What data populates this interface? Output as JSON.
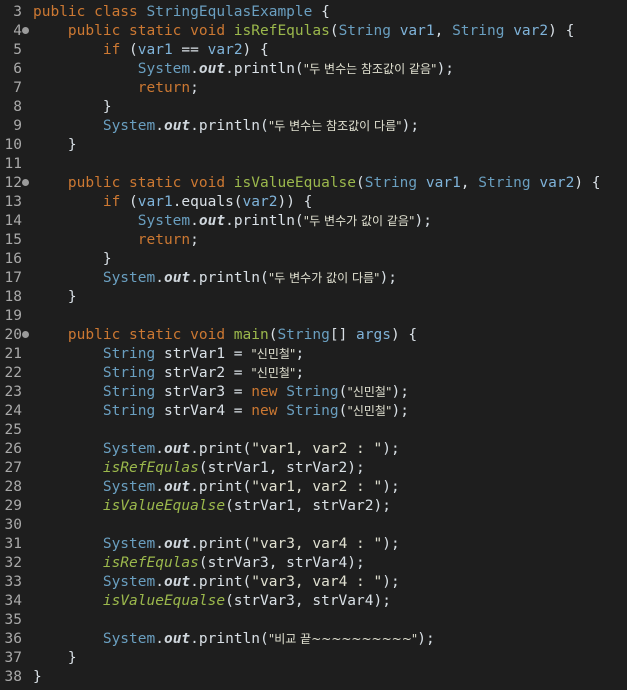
{
  "editor": {
    "lines": [
      {
        "n": "3",
        "fold": false,
        "t": [
          [
            "kw",
            "public "
          ],
          [
            "kw",
            "class "
          ],
          [
            "cls",
            "StringEqulasExample"
          ],
          [
            "pl",
            " {"
          ]
        ]
      },
      {
        "n": "4",
        "fold": true,
        "t": [
          [
            "pl",
            "    "
          ],
          [
            "kw",
            "public "
          ],
          [
            "kw",
            "static "
          ],
          [
            "kw",
            "void "
          ],
          [
            "mth",
            "isRefEqulas"
          ],
          [
            "pl",
            "("
          ],
          [
            "cls",
            "String"
          ],
          [
            "pl",
            " "
          ],
          [
            "var",
            "var1"
          ],
          [
            "pl",
            ", "
          ],
          [
            "cls",
            "String"
          ],
          [
            "pl",
            " "
          ],
          [
            "var",
            "var2"
          ],
          [
            "pl",
            ") {"
          ]
        ]
      },
      {
        "n": "5",
        "fold": false,
        "t": [
          [
            "pl",
            "        "
          ],
          [
            "kw",
            "if "
          ],
          [
            "pl",
            "("
          ],
          [
            "var",
            "var1"
          ],
          [
            "pl",
            " == "
          ],
          [
            "var",
            "var2"
          ],
          [
            "pl",
            ") {"
          ]
        ]
      },
      {
        "n": "6",
        "fold": false,
        "t": [
          [
            "pl",
            "            "
          ],
          [
            "cls",
            "System"
          ],
          [
            "pl",
            "."
          ],
          [
            "fld",
            "out"
          ],
          [
            "pl",
            ".println("
          ],
          [
            "str",
            "\"두 변수는 참조값이 같음\""
          ],
          [
            "pl",
            ");"
          ]
        ]
      },
      {
        "n": "7",
        "fold": false,
        "t": [
          [
            "pl",
            "            "
          ],
          [
            "kw",
            "return"
          ],
          [
            "pl",
            ";"
          ]
        ]
      },
      {
        "n": "8",
        "fold": false,
        "t": [
          [
            "pl",
            "        }"
          ]
        ]
      },
      {
        "n": "9",
        "fold": false,
        "t": [
          [
            "pl",
            "        "
          ],
          [
            "cls",
            "System"
          ],
          [
            "pl",
            "."
          ],
          [
            "fld",
            "out"
          ],
          [
            "pl",
            ".println("
          ],
          [
            "str",
            "\"두 변수는 참조값이 다름\""
          ],
          [
            "pl",
            ");"
          ]
        ]
      },
      {
        "n": "10",
        "fold": false,
        "t": [
          [
            "pl",
            "    }"
          ]
        ]
      },
      {
        "n": "11",
        "fold": false,
        "t": []
      },
      {
        "n": "12",
        "fold": true,
        "t": [
          [
            "pl",
            "    "
          ],
          [
            "kw",
            "public "
          ],
          [
            "kw",
            "static "
          ],
          [
            "kw",
            "void "
          ],
          [
            "mth",
            "isValueEqualse"
          ],
          [
            "pl",
            "("
          ],
          [
            "cls",
            "String"
          ],
          [
            "pl",
            " "
          ],
          [
            "var",
            "var1"
          ],
          [
            "pl",
            ", "
          ],
          [
            "cls",
            "String"
          ],
          [
            "pl",
            " "
          ],
          [
            "var",
            "var2"
          ],
          [
            "pl",
            ") {"
          ]
        ]
      },
      {
        "n": "13",
        "fold": false,
        "t": [
          [
            "pl",
            "        "
          ],
          [
            "kw",
            "if "
          ],
          [
            "pl",
            "("
          ],
          [
            "var",
            "var1"
          ],
          [
            "pl",
            ".equals("
          ],
          [
            "var",
            "var2"
          ],
          [
            "pl",
            ")) {"
          ]
        ]
      },
      {
        "n": "14",
        "fold": false,
        "t": [
          [
            "pl",
            "            "
          ],
          [
            "cls",
            "System"
          ],
          [
            "pl",
            "."
          ],
          [
            "fld",
            "out"
          ],
          [
            "pl",
            ".println("
          ],
          [
            "str",
            "\"두 변수가 값이 같음\""
          ],
          [
            "pl",
            ");"
          ]
        ]
      },
      {
        "n": "15",
        "fold": false,
        "t": [
          [
            "pl",
            "            "
          ],
          [
            "kw",
            "return"
          ],
          [
            "pl",
            ";"
          ]
        ]
      },
      {
        "n": "16",
        "fold": false,
        "t": [
          [
            "pl",
            "        }"
          ]
        ]
      },
      {
        "n": "17",
        "fold": false,
        "t": [
          [
            "pl",
            "        "
          ],
          [
            "cls",
            "System"
          ],
          [
            "pl",
            "."
          ],
          [
            "fld",
            "out"
          ],
          [
            "pl",
            ".println("
          ],
          [
            "str",
            "\"두 변수가 값이 다름\""
          ],
          [
            "pl",
            ");"
          ]
        ]
      },
      {
        "n": "18",
        "fold": false,
        "t": [
          [
            "pl",
            "    }"
          ]
        ]
      },
      {
        "n": "19",
        "fold": false,
        "t": []
      },
      {
        "n": "20",
        "fold": true,
        "t": [
          [
            "pl",
            "    "
          ],
          [
            "kw",
            "public "
          ],
          [
            "kw",
            "static "
          ],
          [
            "kw",
            "void "
          ],
          [
            "mth",
            "main"
          ],
          [
            "pl",
            "("
          ],
          [
            "cls",
            "String"
          ],
          [
            "pl",
            "[] "
          ],
          [
            "var",
            "args"
          ],
          [
            "pl",
            ") {"
          ]
        ]
      },
      {
        "n": "21",
        "fold": false,
        "t": [
          [
            "pl",
            "        "
          ],
          [
            "cls",
            "String"
          ],
          [
            "pl",
            " strVar1 = "
          ],
          [
            "str",
            "\"신민철\""
          ],
          [
            "pl",
            ";"
          ]
        ]
      },
      {
        "n": "22",
        "fold": false,
        "t": [
          [
            "pl",
            "        "
          ],
          [
            "cls",
            "String"
          ],
          [
            "pl",
            " strVar2 = "
          ],
          [
            "str",
            "\"신민철\""
          ],
          [
            "pl",
            ";"
          ]
        ]
      },
      {
        "n": "23",
        "fold": false,
        "t": [
          [
            "pl",
            "        "
          ],
          [
            "cls",
            "String"
          ],
          [
            "pl",
            " strVar3 = "
          ],
          [
            "kw",
            "new "
          ],
          [
            "cls",
            "String"
          ],
          [
            "pl",
            "("
          ],
          [
            "str",
            "\"신민철\""
          ],
          [
            "pl",
            ");"
          ]
        ]
      },
      {
        "n": "24",
        "fold": false,
        "t": [
          [
            "pl",
            "        "
          ],
          [
            "cls",
            "String"
          ],
          [
            "pl",
            " strVar4 = "
          ],
          [
            "kw",
            "new "
          ],
          [
            "cls",
            "String"
          ],
          [
            "pl",
            "("
          ],
          [
            "str",
            "\"신민철\""
          ],
          [
            "pl",
            ");"
          ]
        ]
      },
      {
        "n": "25",
        "fold": false,
        "t": []
      },
      {
        "n": "26",
        "fold": false,
        "t": [
          [
            "pl",
            "        "
          ],
          [
            "cls",
            "System"
          ],
          [
            "pl",
            "."
          ],
          [
            "fld",
            "out"
          ],
          [
            "pl",
            ".print("
          ],
          [
            "str",
            "\"var1, var2 : \""
          ],
          [
            "pl",
            ");"
          ]
        ]
      },
      {
        "n": "27",
        "fold": false,
        "t": [
          [
            "pl",
            "        "
          ],
          [
            "stc",
            "isRefEqulas"
          ],
          [
            "pl",
            "(strVar1, strVar2);"
          ]
        ]
      },
      {
        "n": "28",
        "fold": false,
        "t": [
          [
            "pl",
            "        "
          ],
          [
            "cls",
            "System"
          ],
          [
            "pl",
            "."
          ],
          [
            "fld",
            "out"
          ],
          [
            "pl",
            ".print("
          ],
          [
            "str",
            "\"var1, var2 : \""
          ],
          [
            "pl",
            ");"
          ]
        ]
      },
      {
        "n": "29",
        "fold": false,
        "t": [
          [
            "pl",
            "        "
          ],
          [
            "stc",
            "isValueEqualse"
          ],
          [
            "pl",
            "(strVar1, strVar2);"
          ]
        ]
      },
      {
        "n": "30",
        "fold": false,
        "t": []
      },
      {
        "n": "31",
        "fold": false,
        "t": [
          [
            "pl",
            "        "
          ],
          [
            "cls",
            "System"
          ],
          [
            "pl",
            "."
          ],
          [
            "fld",
            "out"
          ],
          [
            "pl",
            ".print("
          ],
          [
            "str",
            "\"var3, var4 : \""
          ],
          [
            "pl",
            ");"
          ]
        ]
      },
      {
        "n": "32",
        "fold": false,
        "t": [
          [
            "pl",
            "        "
          ],
          [
            "stc",
            "isRefEqulas"
          ],
          [
            "pl",
            "(strVar3, strVar4);"
          ]
        ]
      },
      {
        "n": "33",
        "fold": false,
        "t": [
          [
            "pl",
            "        "
          ],
          [
            "cls",
            "System"
          ],
          [
            "pl",
            "."
          ],
          [
            "fld",
            "out"
          ],
          [
            "pl",
            ".print("
          ],
          [
            "str",
            "\"var3, var4 : \""
          ],
          [
            "pl",
            ");"
          ]
        ]
      },
      {
        "n": "34",
        "fold": false,
        "t": [
          [
            "pl",
            "        "
          ],
          [
            "stc",
            "isValueEqualse"
          ],
          [
            "pl",
            "(strVar3, strVar4);"
          ]
        ]
      },
      {
        "n": "35",
        "fold": false,
        "t": []
      },
      {
        "n": "36",
        "fold": false,
        "t": [
          [
            "pl",
            "        "
          ],
          [
            "cls",
            "System"
          ],
          [
            "pl",
            "."
          ],
          [
            "fld",
            "out"
          ],
          [
            "pl",
            ".println("
          ],
          [
            "str",
            "\"비교 끝~~~~~~~~~~\""
          ],
          [
            "pl",
            ");"
          ]
        ]
      },
      {
        "n": "37",
        "fold": false,
        "t": [
          [
            "pl",
            "    }"
          ]
        ]
      },
      {
        "n": "38",
        "fold": false,
        "t": [
          [
            "pl",
            "}"
          ]
        ]
      }
    ]
  },
  "colors": {
    "background": "#1e1e1e",
    "keyword": "#cc7832",
    "type": "#6a9fc0",
    "method": "#9bb84c",
    "variable": "#7fb3d9",
    "line_number": "#a9a9a9"
  }
}
